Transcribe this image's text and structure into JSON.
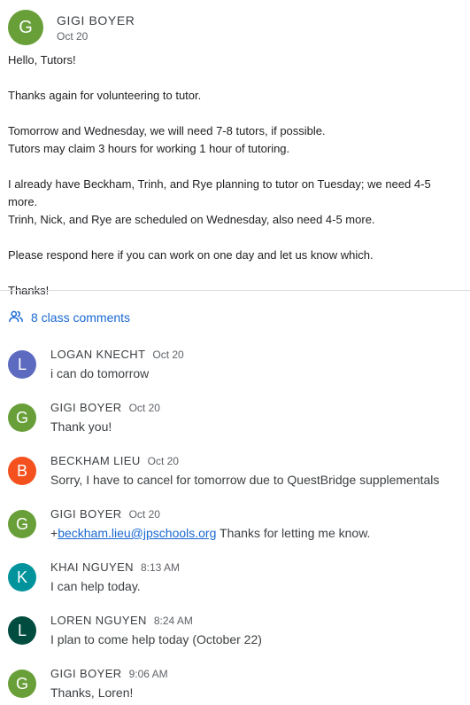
{
  "post": {
    "avatar_letter": "G",
    "avatar_color": "#689f38",
    "author": "GIGI BOYER",
    "date": "Oct 20",
    "lines": {
      "p1": "Hello, Tutors!",
      "p2": "Thanks again for volunteering to tutor.",
      "p3a": "Tomorrow and Wednesday, we will need 7-8 tutors, if possible.",
      "p3b": "Tutors may claim 3 hours for working 1 hour of tutoring.",
      "p4a": "I already have Beckham, Trinh, and Rye planning to tutor on Tuesday; we need 4-5 more.",
      "p4b": "Trinh, Nick, and Rye are scheduled on Wednesday, also need 4-5 more.",
      "p5": "Please respond here if you can work on one day and let us know which.",
      "p6": "Thanks!"
    }
  },
  "comments_link": {
    "icon": "people-icon",
    "label": "8 class comments",
    "color": "#1967d2"
  },
  "comments": [
    {
      "letter": "L",
      "color": "#5c6bc0",
      "name": "LOGAN KNECHT",
      "time": "Oct 20",
      "text": "i can do tomorrow"
    },
    {
      "letter": "G",
      "color": "#689f38",
      "name": "GIGI BOYER",
      "time": "Oct 20",
      "text": "Thank you!"
    },
    {
      "letter": "B",
      "color": "#f4511e",
      "name": "BECKHAM LIEU",
      "time": "Oct 20",
      "text": "Sorry, I have to cancel for tomorrow due to QuestBridge supplementals"
    },
    {
      "letter": "G",
      "color": "#689f38",
      "name": "GIGI BOYER",
      "time": "Oct 20",
      "mention": "beckham.lieu@jpschools.org",
      "text": "Thanks for letting me know."
    },
    {
      "letter": "K",
      "color": "#00939c",
      "name": "KHAI NGUYEN",
      "time": "8:13 AM",
      "text": "I can help today."
    },
    {
      "letter": "L",
      "color": "#004d40",
      "name": "LOREN NGUYEN",
      "time": "8:24 AM",
      "text": "I plan to come help today (October 22)"
    },
    {
      "letter": "G",
      "color": "#689f38",
      "name": "GIGI BOYER",
      "time": "9:06 AM",
      "text": "Thanks, Loren!"
    }
  ]
}
